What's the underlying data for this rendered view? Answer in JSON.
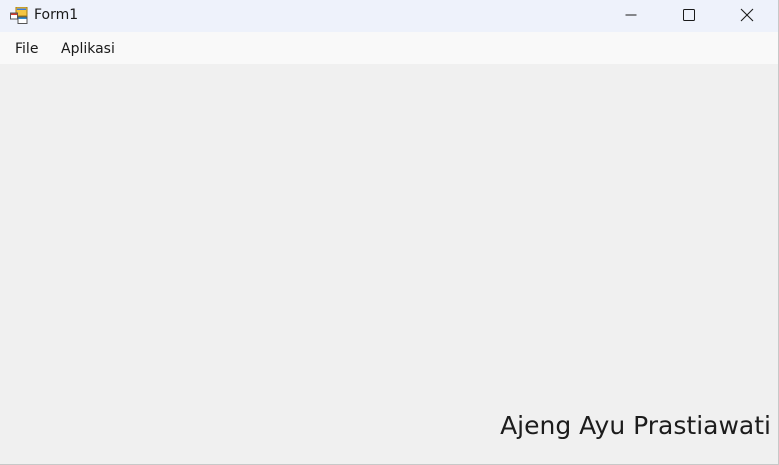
{
  "window": {
    "title": "Form1",
    "app_icon": "form-app-icon",
    "controls": {
      "minimize_icon": "minimize-icon",
      "maximize_icon": "maximize-icon",
      "close_icon": "close-icon"
    }
  },
  "menubar": {
    "items": [
      {
        "label": "File"
      },
      {
        "label": "Aplikasi"
      }
    ]
  },
  "content": {
    "name_label": "Ajeng Ayu Prastiawati"
  },
  "colors": {
    "titlebar_bg": "#eef2fb",
    "menubar_bg": "#f9f9f9",
    "client_bg": "#f0f0f0"
  }
}
